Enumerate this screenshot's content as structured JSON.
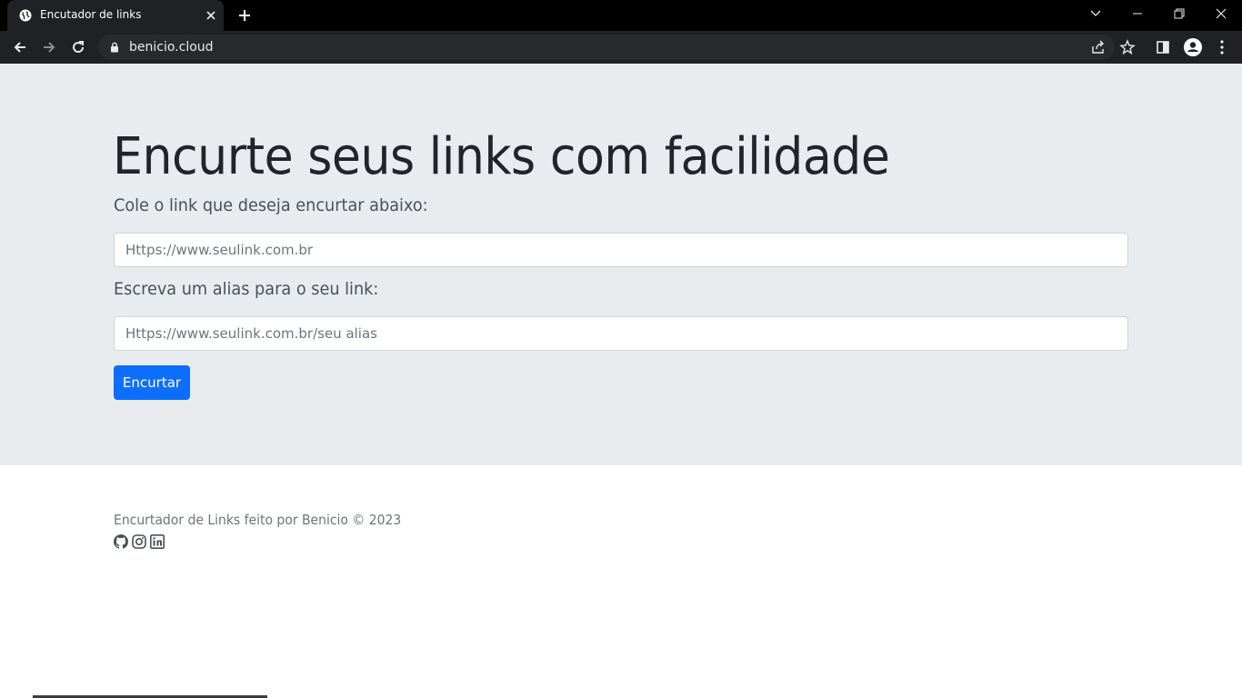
{
  "browser": {
    "tab_title": "Encutador de links",
    "url": "benicio.cloud",
    "icons": [
      "globe-icon",
      "close-icon",
      "plus-icon",
      "back-icon",
      "forward-icon",
      "reload-icon",
      "lock-icon",
      "share-icon",
      "star-icon",
      "side-panel-icon",
      "profile-icon",
      "menu-icon",
      "minimize-icon",
      "restore-icon",
      "close-window-icon",
      "tab-search-icon"
    ]
  },
  "hero": {
    "title": "Encurte seus links com facilidade",
    "url_label": "Cole o link que deseja encurtar abaixo:",
    "url_placeholder": "Https://www.seulink.com.br",
    "alias_label": "Escreva um alias para o seu link:",
    "alias_placeholder": "Https://www.seulink.com.br/seu alias",
    "submit_label": "Encurtar"
  },
  "footer": {
    "text": "Encurtador de Links feito por Benicio © 2023",
    "social_icons": [
      "github-icon",
      "instagram-icon",
      "linkedin-icon"
    ]
  },
  "colors": {
    "hero_bg": "#e9ecef",
    "primary": "#0d6efd",
    "chrome_bg": "#202124"
  }
}
